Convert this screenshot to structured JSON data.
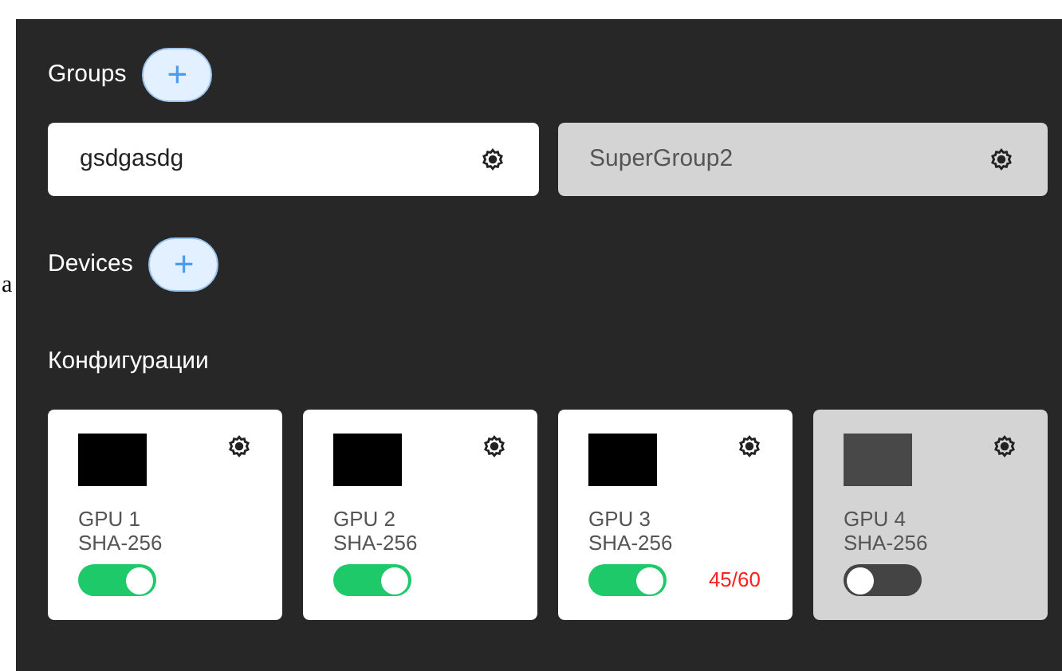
{
  "stray_text": "a",
  "groups": {
    "title": "Groups",
    "add_label": "+",
    "items": [
      {
        "name": "gsdgasdg",
        "active": true
      },
      {
        "name": "SuperGroup2",
        "active": false
      }
    ]
  },
  "devices": {
    "title": "Devices",
    "add_label": "+"
  },
  "configurations": {
    "title": "Конфигурации",
    "items": [
      {
        "name": "GPU 1",
        "algorithm": "SHA-256",
        "on": true
      },
      {
        "name": "GPU 2",
        "algorithm": "SHA-256",
        "on": true
      },
      {
        "name": "GPU 3",
        "algorithm": "SHA-256",
        "on": true,
        "counter": "45/60"
      },
      {
        "name": "GPU 4",
        "algorithm": "SHA-256",
        "on": false
      }
    ]
  }
}
